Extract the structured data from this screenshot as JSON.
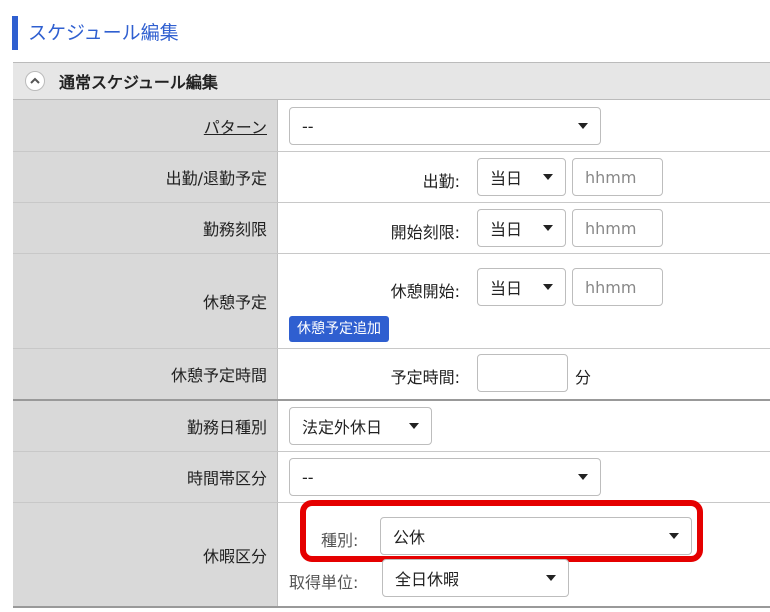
{
  "page": {
    "title": "スケジュール編集"
  },
  "section": {
    "title": "通常スケジュール編集",
    "collapse_icon": "chevron-up-icon"
  },
  "rows": {
    "pattern": {
      "label": "パターン",
      "select_value": "--"
    },
    "attendance": {
      "label": "出勤/退勤予定",
      "field_label": "出勤:",
      "day_value": "当日",
      "time_placeholder": "hhmm"
    },
    "limit": {
      "label": "勤務刻限",
      "field_label": "開始刻限:",
      "day_value": "当日",
      "time_placeholder": "hhmm"
    },
    "break": {
      "label": "休憩予定",
      "field_label": "休憩開始:",
      "day_value": "当日",
      "time_placeholder": "hhmm",
      "add_button": "休憩予定追加"
    },
    "break_time": {
      "label": "休憩予定時間",
      "field_label": "予定時間:",
      "value": "",
      "unit": "分"
    },
    "work_day_type": {
      "label": "勤務日種別",
      "select_value": "法定外休日"
    },
    "time_zone": {
      "label": "時間帯区分",
      "select_value": "--"
    },
    "leave": {
      "label": "休暇区分",
      "type_label": "種別:",
      "type_value": "公休",
      "unit_label": "取得単位:",
      "unit_value": "全日休暇"
    }
  },
  "colors": {
    "accent": "#2f5fd0",
    "highlight": "#e50000",
    "label_bg": "#d9d9d9"
  }
}
